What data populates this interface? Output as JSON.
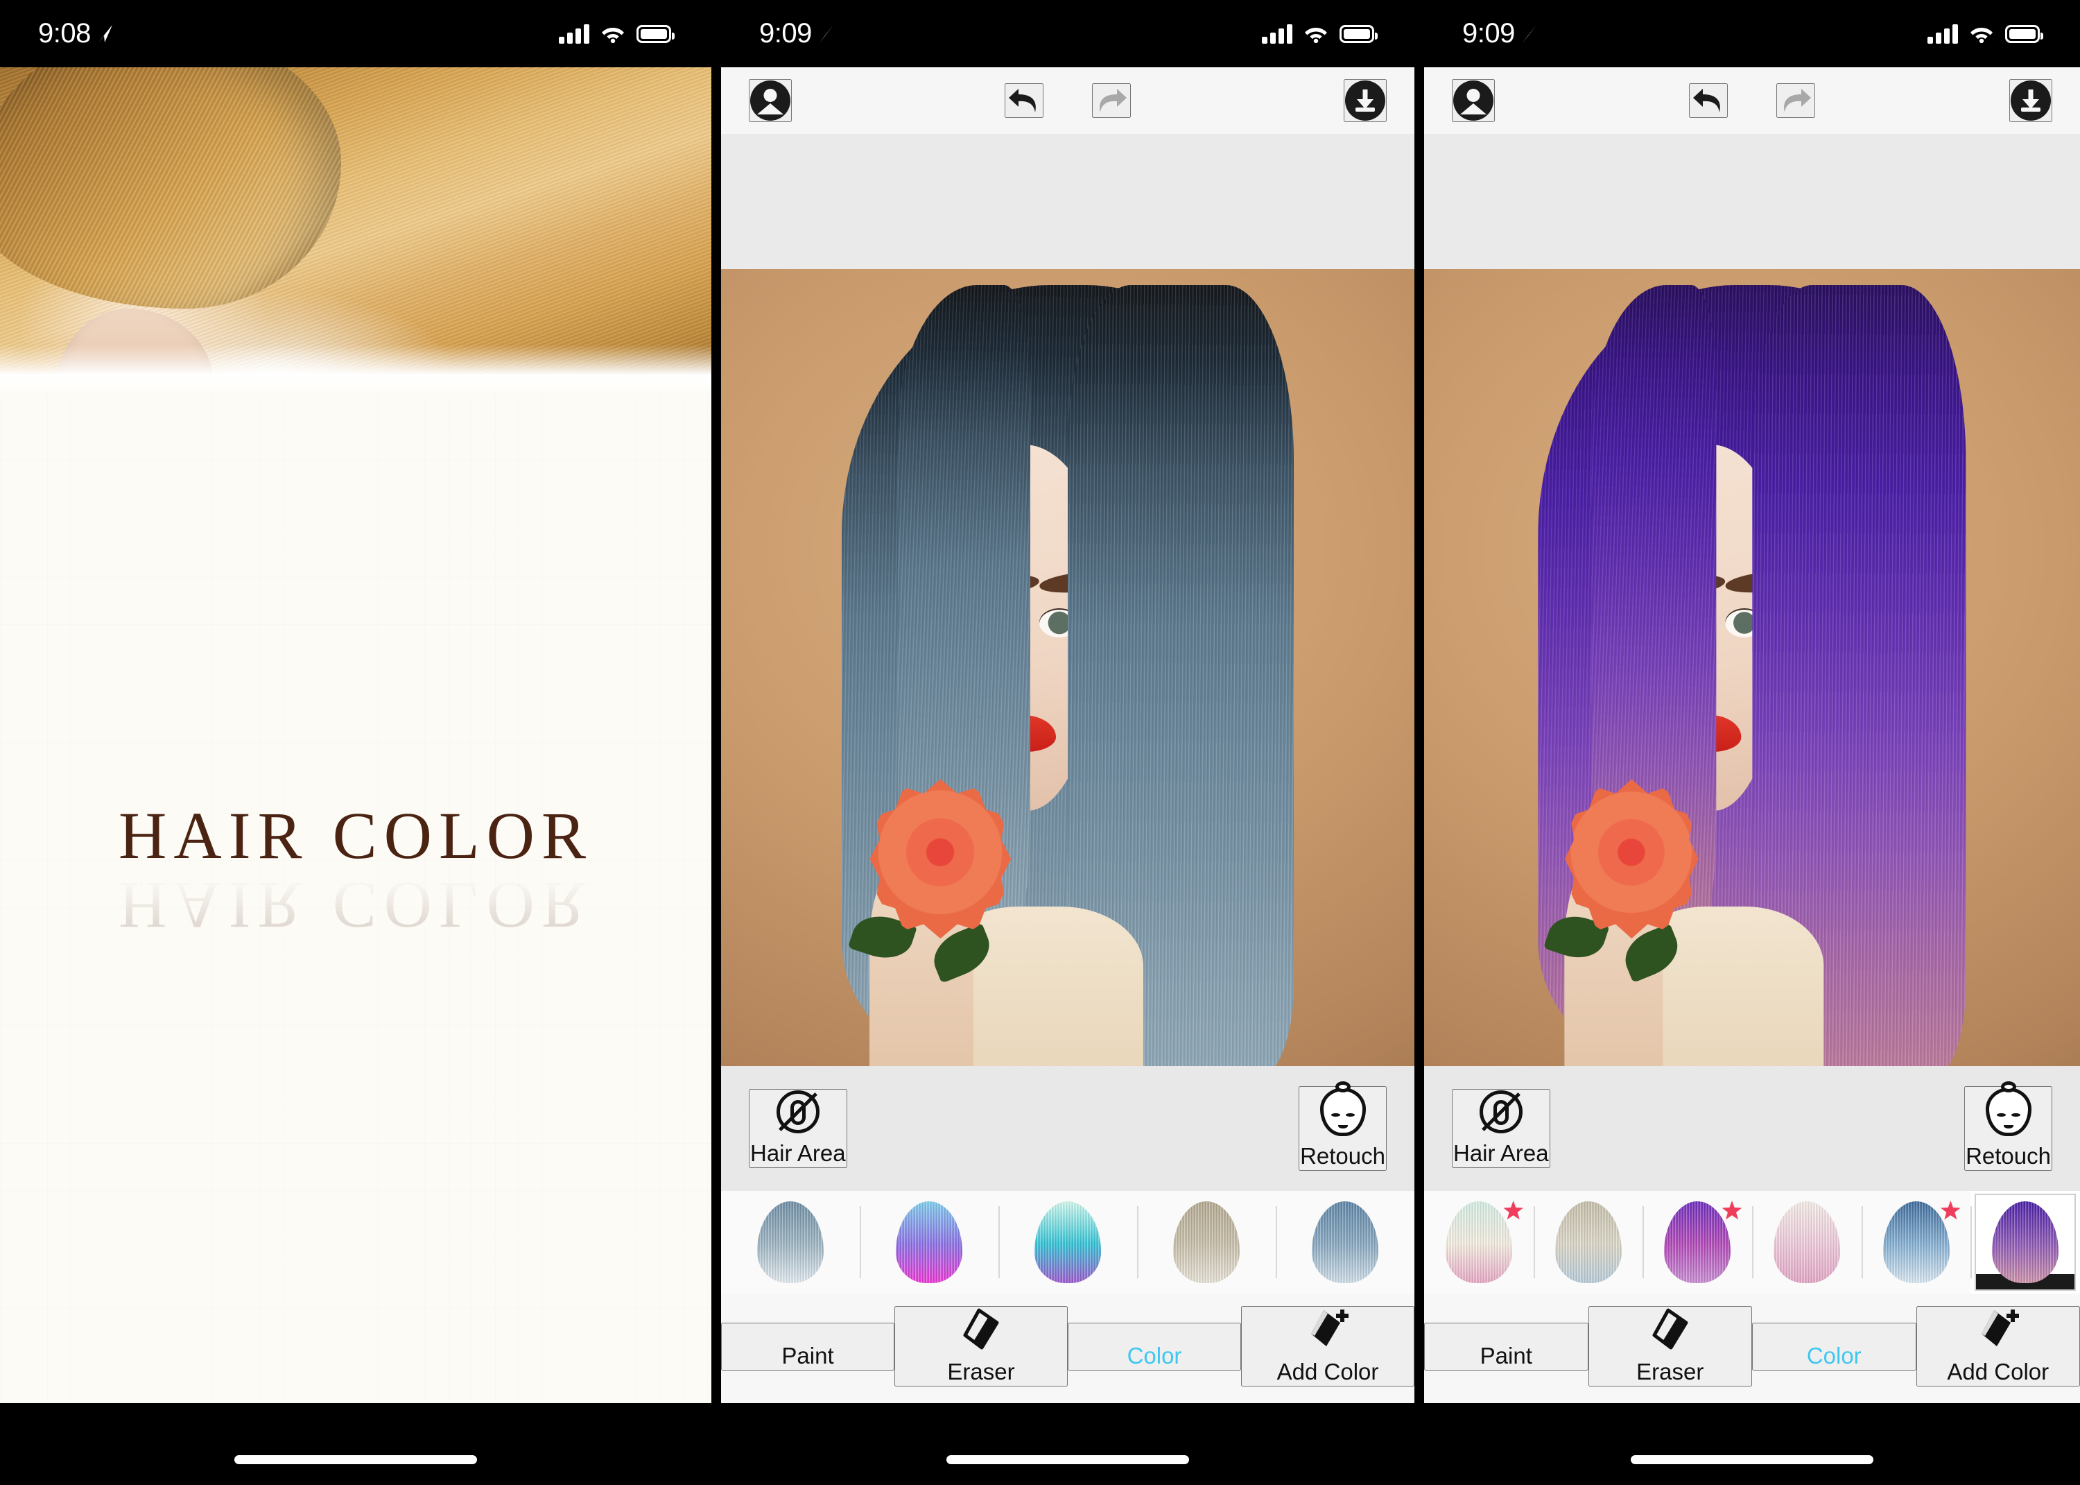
{
  "app": {
    "name": "Hair Color",
    "accent_active": "#3fc7ef",
    "badge_color": "#ef3d5c",
    "splash_title_color": "#4b2312"
  },
  "panels": [
    {
      "id": "splash",
      "status": {
        "time": "9:08",
        "location_icon": "location-arrow-icon",
        "signal": "cellular-signal-icon",
        "wifi": "wifi-icon",
        "battery": "battery-full-icon"
      },
      "splash": {
        "title": "HAIR COLOR",
        "photo_alt": "golden-blonde-hair-photo"
      }
    },
    {
      "id": "editor-blue",
      "status": {
        "time": "9:09",
        "location_icon": "location-arrow-icon",
        "signal": "cellular-signal-icon",
        "wifi": "wifi-icon",
        "battery": "battery-full-icon"
      },
      "toolbar": {
        "profile_label": "profile-icon",
        "undo_label": "undo-icon",
        "redo_label": "redo-icon",
        "save_label": "download-icon",
        "undo_enabled": "true",
        "redo_enabled": "false"
      },
      "photo": {
        "hair_color": "blue-grey",
        "subject": "woman-holding-orange-rose"
      },
      "tools": {
        "hair_area_label": "Hair Area",
        "retouch_label": "Retouch"
      },
      "swatches": [
        {
          "name": "steel-blue-ombre",
          "top": "#6f8fa6",
          "mid": "#9fb6c4",
          "bottom": "#e4ecf1",
          "starred": false,
          "selected": false
        },
        {
          "name": "blue-magenta-ombre",
          "top": "#7fd0ef",
          "mid": "#8d72e8",
          "bottom": "#ef38d8",
          "starred": false,
          "selected": false
        },
        {
          "name": "mint-cyan-violet-ombre",
          "top": "#d4fbf0",
          "mid": "#33c6d8",
          "bottom": "#a05ad2",
          "starred": false,
          "selected": false
        },
        {
          "name": "ash-blonde",
          "top": "#b5ab92",
          "mid": "#c9c0ab",
          "bottom": "#e9e4d9",
          "starred": false,
          "selected": false
        },
        {
          "name": "denim-blue",
          "top": "#5e86a8",
          "mid": "#89a9c1",
          "bottom": "#d2e0ea",
          "starred": false,
          "selected": false
        }
      ],
      "tabs": [
        {
          "label": "Paint",
          "icon": "paint-brush-icon",
          "active": false
        },
        {
          "label": "Eraser",
          "icon": "eraser-icon",
          "active": false
        },
        {
          "label": "Color",
          "icon": "color-tube-icon",
          "active": true
        },
        {
          "label": "Add Color",
          "icon": "add-color-icon",
          "active": false
        }
      ]
    },
    {
      "id": "editor-purple",
      "status": {
        "time": "9:09",
        "location_icon": "location-arrow-icon",
        "signal": "cellular-signal-icon",
        "wifi": "wifi-icon",
        "battery": "battery-full-icon"
      },
      "toolbar": {
        "profile_label": "profile-icon",
        "undo_label": "undo-icon",
        "redo_label": "redo-icon",
        "save_label": "download-icon",
        "undo_enabled": "true",
        "redo_enabled": "false"
      },
      "photo": {
        "hair_color": "purple",
        "subject": "woman-holding-orange-rose"
      },
      "tools": {
        "hair_area_label": "Hair Area",
        "retouch_label": "Retouch"
      },
      "swatches": [
        {
          "name": "mint-cream-pink-ombre",
          "top": "#d6efe6",
          "mid": "#f6efe2",
          "bottom": "#e9a8c6",
          "starred": true,
          "selected": false
        },
        {
          "name": "ash-silver-blue",
          "top": "#c7c0ab",
          "mid": "#ddd8c8",
          "bottom": "#b9cddc",
          "starred": false,
          "selected": false
        },
        {
          "name": "violet-magenta-ombre",
          "top": "#6f2fbe",
          "mid": "#b348b9",
          "bottom": "#c98fd4",
          "starred": true,
          "selected": false
        },
        {
          "name": "cream-pink-ombre",
          "top": "#f7efea",
          "mid": "#f0cbdd",
          "bottom": "#e5a7c7",
          "starred": false,
          "selected": false
        },
        {
          "name": "navy-ice-blue-ombre",
          "top": "#3e6c9e",
          "mid": "#86b1d4",
          "bottom": "#dbe9f4",
          "starred": true,
          "selected": false
        },
        {
          "name": "purple-rose-ombre",
          "top": "#4a1fa8",
          "mid": "#8f5ab7",
          "bottom": "#cf93ab",
          "starred": false,
          "selected": true
        }
      ],
      "tabs": [
        {
          "label": "Paint",
          "icon": "paint-brush-icon",
          "active": false
        },
        {
          "label": "Eraser",
          "icon": "eraser-icon",
          "active": false
        },
        {
          "label": "Color",
          "icon": "color-tube-icon",
          "active": true
        },
        {
          "label": "Add Color",
          "icon": "add-color-icon",
          "active": false
        }
      ]
    }
  ]
}
